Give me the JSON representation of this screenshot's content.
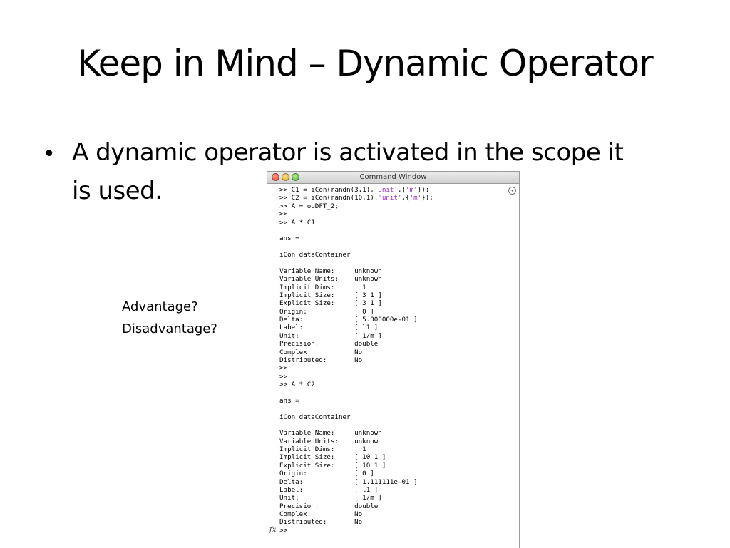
{
  "slide": {
    "title": "Keep in Mind – Dynamic Operator",
    "bullet_symbol": "•",
    "bullet_lines": [
      "A dynamic operator is activated in the scope it",
      "is used."
    ],
    "questions": [
      "Advantage?",
      "Disadvantage?"
    ]
  },
  "command_window": {
    "title": "Command Window",
    "fx_label": "fx",
    "string_color": "#9b30c6",
    "commands": {
      "c1_pre": ">> C1 = iCon(randn(3,1),",
      "c1_unit": "'unit'",
      "c1_mid": ",{",
      "c1_m": "'m'",
      "c1_post": "});",
      "c2_pre": ">> C2 = iCon(randn(10,1),",
      "c2_unit": "'unit'",
      "c2_mid": ",{",
      "c2_m": "'m'",
      "c2_post": "});",
      "a_def": ">> A = opDFT_2;",
      "blank_prompt": ">>",
      "a_c1": ">> A * C1",
      "a_c2": ">> A * C2",
      "final_prompt": ">>"
    },
    "ans_label": "ans =",
    "container_label": "iCon dataContainer",
    "output1": {
      "variable_name": "Variable Name:     unknown",
      "variable_units": "Variable Units:    unknown",
      "implicit_dims": "Implicit Dims:       1",
      "implicit_size": "Implicit Size:     [ 3 1 ]",
      "explicit_size": "Explicit Size:     [ 3 1 ]",
      "origin": "Origin:            [ 0 ]",
      "delta": "Delta:             [ 5.000000e-01 ]",
      "label": "Label:             [ l1 ]",
      "unit": "Unit:              [ 1/m ]",
      "precision": "Precision:         double",
      "complex": "Complex:           No",
      "distributed": "Distributed:       No"
    },
    "output2": {
      "variable_name": "Variable Name:     unknown",
      "variable_units": "Variable Units:    unknown",
      "implicit_dims": "Implicit Dims:       1",
      "implicit_size": "Implicit Size:     [ 10 1 ]",
      "explicit_size": "Explicit Size:     [ 10 1 ]",
      "origin": "Origin:            [ 0 ]",
      "delta": "Delta:             [ 1.111111e-01 ]",
      "label": "Label:             [ l1 ]",
      "unit": "Unit:              [ 1/m ]",
      "precision": "Precision:         double",
      "complex": "Complex:           No",
      "distributed": "Distributed:       No"
    }
  }
}
